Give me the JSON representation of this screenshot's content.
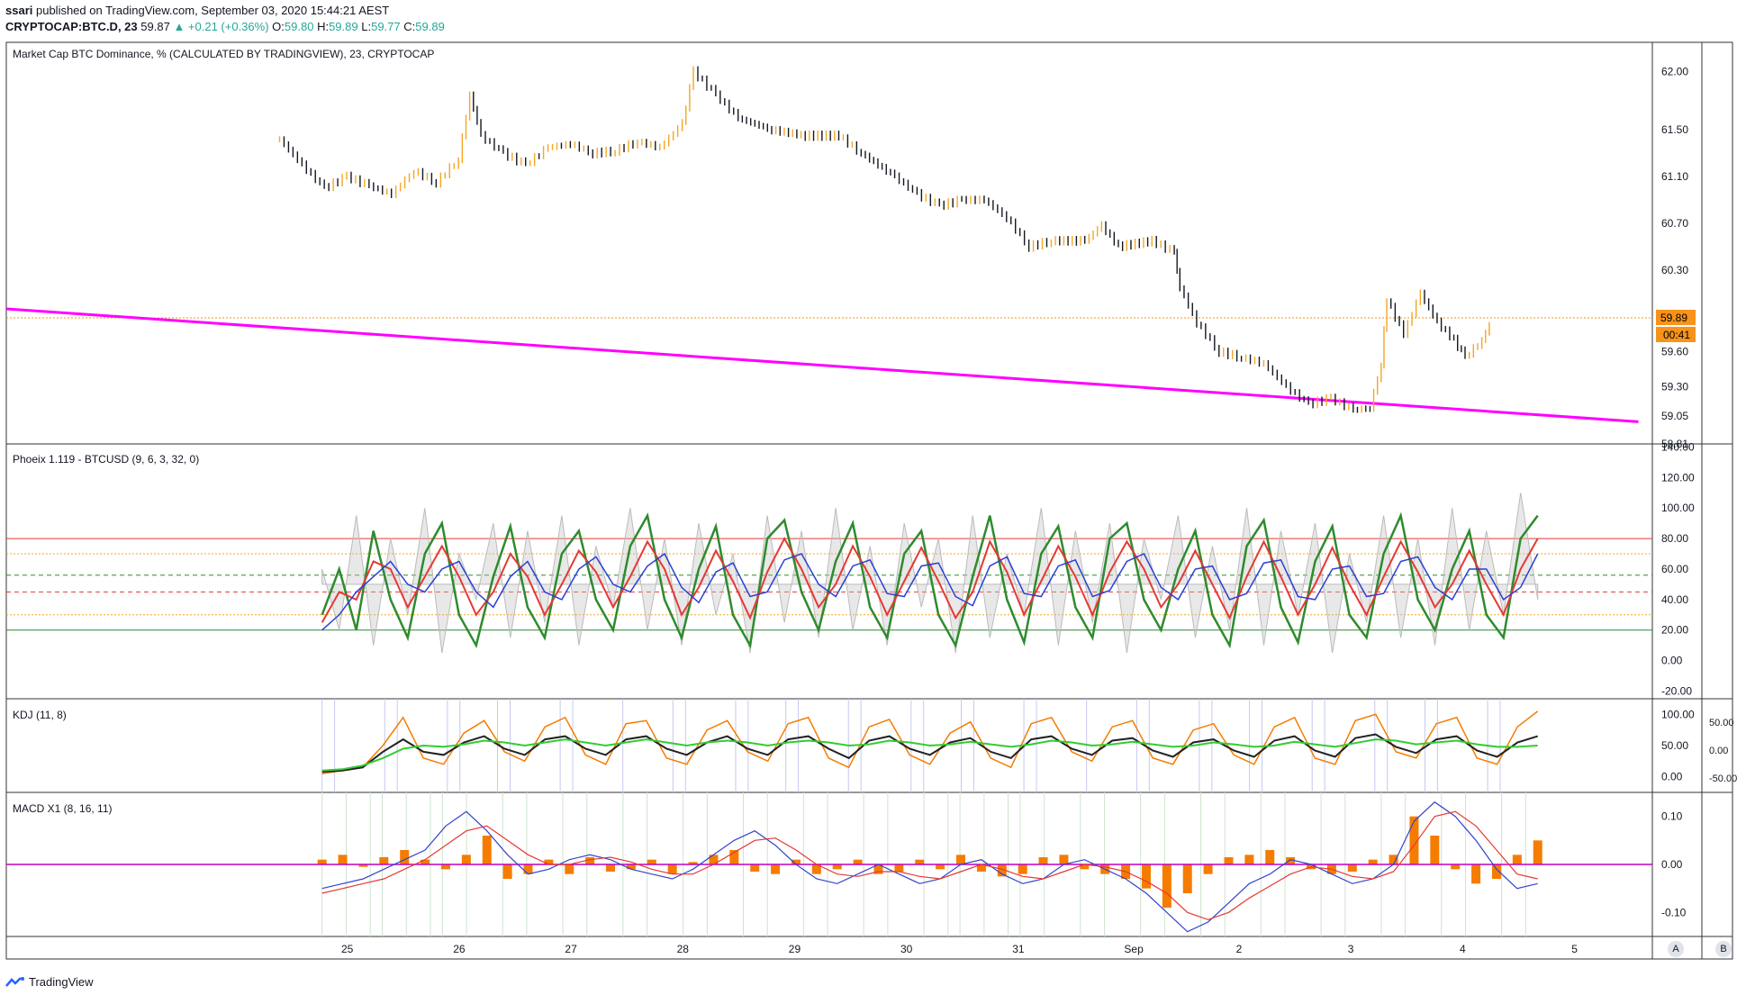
{
  "header": {
    "publisher": "ssari",
    "published_text": " published on TradingView.com, September 03, 2020 15:44:21 AEST",
    "symbol": "CRYPTOCAP:BTC.D, 23",
    "last": "59.87",
    "change": "▲ +0.21 (+0.36%)",
    "o_label": "O:",
    "o": "59.80",
    "h_label": "H:",
    "h": "59.89",
    "l_label": "L:",
    "l": "59.77",
    "c_label": "C:",
    "c": "59.89"
  },
  "panes": {
    "main_title": "Market Cap BTC Dominance, % (CALCULATED BY TRADINGVIEW), 23, CRYPTOCAP",
    "phoeix_title": "Phoeix 1.119 - BTCUSD (9, 6, 3, 32, 0)",
    "kdj_title": "KDJ (11, 8)",
    "macd_title": "MACD X1 (8, 16, 11)"
  },
  "footer": {
    "brand": "TradingView"
  },
  "buttons": {
    "a": "A",
    "b": "B"
  },
  "colors": {
    "candle": "#131722",
    "up_candle": "#f5a623",
    "trendline": "#ff00ff",
    "price_line": "#f7931a",
    "phoeix_green": "#2e8b2e",
    "phoeix_red": "#e53935",
    "phoeix_blue": "#2b3fd6",
    "kdj_k": "#f57c00",
    "kdj_d": "#222222",
    "kdj_j": "#33cc33",
    "macd_hist": "#f57c00",
    "macd_line": "#3344cc",
    "signal_line": "#e53935",
    "zero_line": "#c000c0"
  },
  "chart_data": [
    {
      "type": "line",
      "title": "Market Cap BTC Dominance, % (CALCULATED BY TRADINGVIEW), 23, CRYPTOCAP",
      "x_ticks": [
        "25",
        "26",
        "27",
        "28",
        "29",
        "30",
        "31",
        "Sep",
        "2",
        "3",
        "4",
        "5"
      ],
      "y_ticks": [
        "62.00",
        "61.50",
        "61.10",
        "60.70",
        "60.30",
        "59.89",
        "59.60",
        "59.30",
        "59.05",
        "58.81"
      ],
      "price_badge": "59.89",
      "time_badge": "00:41",
      "ylim": [
        58.81,
        62.25
      ],
      "series": [
        {
          "values": [
            [
              24.4,
              61.42
            ],
            [
              24.6,
              61.2
            ],
            [
              24.8,
              61.0
            ],
            [
              25.0,
              61.1
            ],
            [
              25.2,
              61.02
            ],
            [
              25.4,
              60.95
            ],
            [
              25.6,
              61.15
            ],
            [
              25.8,
              61.05
            ],
            [
              26.0,
              61.25
            ],
            [
              26.1,
              61.8
            ],
            [
              26.2,
              61.45
            ],
            [
              26.4,
              61.3
            ],
            [
              26.6,
              61.2
            ],
            [
              26.8,
              61.35
            ],
            [
              27.0,
              61.38
            ],
            [
              27.2,
              61.3
            ],
            [
              27.4,
              61.32
            ],
            [
              27.6,
              61.4
            ],
            [
              27.8,
              61.35
            ],
            [
              28.0,
              61.55
            ],
            [
              28.1,
              62.0
            ],
            [
              28.3,
              61.8
            ],
            [
              28.5,
              61.6
            ],
            [
              28.8,
              61.5
            ],
            [
              29.1,
              61.45
            ],
            [
              29.4,
              61.45
            ],
            [
              29.6,
              61.3
            ],
            [
              29.9,
              61.1
            ],
            [
              30.1,
              60.95
            ],
            [
              30.3,
              60.85
            ],
            [
              30.5,
              60.9
            ],
            [
              30.7,
              60.9
            ],
            [
              30.9,
              60.75
            ],
            [
              31.1,
              60.5
            ],
            [
              31.3,
              60.55
            ],
            [
              31.6,
              60.55
            ],
            [
              31.75,
              60.68
            ],
            [
              31.9,
              60.5
            ],
            [
              32.2,
              60.55
            ],
            [
              32.4,
              60.45
            ],
            [
              32.45,
              60.15
            ],
            [
              32.6,
              59.85
            ],
            [
              32.8,
              59.6
            ],
            [
              33.0,
              59.55
            ],
            [
              33.2,
              59.5
            ],
            [
              33.4,
              59.3
            ],
            [
              33.6,
              59.15
            ],
            [
              33.8,
              59.2
            ],
            [
              34.0,
              59.1
            ],
            [
              34.15,
              59.12
            ],
            [
              34.25,
              59.5
            ],
            [
              34.3,
              60.05
            ],
            [
              34.45,
              59.75
            ],
            [
              34.6,
              60.1
            ],
            [
              34.75,
              59.85
            ],
            [
              34.9,
              59.7
            ],
            [
              35.0,
              59.55
            ],
            [
              35.15,
              59.7
            ],
            [
              35.25,
              59.89
            ]
          ]
        }
      ]
    },
    {
      "type": "line",
      "title": "Phoeix 1.119 - BTCUSD (9, 6, 3, 32, 0)",
      "y_ticks": [
        "140.00",
        "120.00",
        "100.00",
        "80.00",
        "60.00",
        "40.00",
        "20.00",
        "0.00",
        "-20.00"
      ],
      "ylim": [
        -25,
        142
      ],
      "levels": [
        80,
        70,
        56,
        45,
        30,
        20
      ],
      "series": [
        {
          "name": "",
          "values": [
            30,
            60,
            20,
            85,
            40,
            15,
            70,
            90,
            30,
            10,
            55,
            88,
            35,
            15,
            70,
            85,
            40,
            20,
            75,
            95,
            40,
            15,
            60,
            88,
            30,
            10,
            80,
            92,
            45,
            20,
            65,
            90,
            35,
            15,
            70,
            85,
            30,
            10,
            55,
            95,
            40,
            12,
            70,
            88,
            35,
            15,
            80,
            90,
            40,
            20,
            60,
            85,
            30,
            10,
            75,
            92,
            35,
            12,
            65,
            88,
            30,
            15,
            70,
            95,
            40,
            20,
            60,
            85,
            30,
            15,
            80,
            95
          ]
        },
        {
          "name": "",
          "values": [
            25,
            45,
            40,
            65,
            60,
            35,
            55,
            75,
            55,
            30,
            45,
            70,
            55,
            30,
            50,
            72,
            58,
            35,
            55,
            78,
            60,
            30,
            48,
            72,
            52,
            28,
            58,
            80,
            60,
            35,
            50,
            75,
            55,
            30,
            52,
            74,
            52,
            28,
            45,
            78,
            58,
            30,
            52,
            75,
            55,
            30,
            58,
            78,
            60,
            35,
            50,
            72,
            50,
            28,
            55,
            78,
            55,
            30,
            50,
            74,
            50,
            30,
            55,
            78,
            58,
            35,
            50,
            72,
            50,
            30,
            60,
            80
          ]
        },
        {
          "name": "",
          "values": [
            20,
            30,
            45,
            55,
            65,
            50,
            45,
            60,
            65,
            45,
            35,
            55,
            65,
            45,
            40,
            60,
            68,
            50,
            45,
            62,
            70,
            48,
            38,
            58,
            64,
            42,
            45,
            66,
            70,
            50,
            42,
            62,
            66,
            44,
            42,
            62,
            64,
            42,
            36,
            62,
            68,
            44,
            42,
            62,
            66,
            42,
            46,
            65,
            70,
            48,
            40,
            60,
            62,
            40,
            44,
            64,
            66,
            42,
            40,
            60,
            62,
            42,
            44,
            65,
            68,
            48,
            40,
            60,
            60,
            40,
            48,
            70
          ]
        },
        {
          "name": "",
          "values": [
            60,
            20,
            95,
            10,
            80,
            30,
            100,
            5,
            70,
            40,
            90,
            15,
            85,
            25,
            95,
            10,
            75,
            35,
            100,
            20,
            80,
            10,
            90,
            30,
            70,
            5,
            95,
            25,
            85,
            15,
            100,
            20,
            75,
            10,
            90,
            35,
            80,
            5,
            95,
            15,
            70,
            30,
            100,
            10,
            85,
            25,
            90,
            5,
            80,
            40,
            95,
            15,
            75,
            20,
            100,
            10,
            85,
            30,
            90,
            5,
            70,
            25,
            95,
            15,
            80,
            10,
            100,
            20,
            85,
            30,
            110,
            40
          ]
        }
      ]
    },
    {
      "type": "line",
      "title": "KDJ (11, 8)",
      "y_ticks": [
        "100.00",
        "50.00",
        "0.00"
      ],
      "y_ticks_right": [
        "50.00",
        "0.00",
        "-50.00"
      ],
      "ylim": [
        -25,
        125
      ],
      "series": [
        {
          "name": "",
          "values": [
            5,
            10,
            15,
            50,
            95,
            30,
            20,
            70,
            90,
            40,
            25,
            80,
            95,
            35,
            20,
            85,
            90,
            30,
            20,
            75,
            90,
            40,
            25,
            85,
            95,
            30,
            15,
            80,
            92,
            35,
            20,
            70,
            88,
            30,
            15,
            85,
            95,
            40,
            25,
            80,
            90,
            30,
            20,
            75,
            85,
            35,
            20,
            80,
            95,
            30,
            20,
            90,
            100,
            40,
            30,
            85,
            95,
            30,
            20,
            80,
            105
          ]
        },
        {
          "name": "",
          "values": [
            8,
            10,
            15,
            40,
            60,
            40,
            35,
            55,
            65,
            45,
            35,
            60,
            65,
            45,
            35,
            60,
            65,
            45,
            35,
            55,
            65,
            45,
            35,
            60,
            65,
            45,
            30,
            58,
            65,
            45,
            35,
            55,
            62,
            40,
            30,
            60,
            65,
            45,
            35,
            58,
            62,
            42,
            32,
            55,
            60,
            42,
            32,
            58,
            65,
            42,
            32,
            62,
            68,
            48,
            38,
            60,
            65,
            42,
            32,
            55,
            65
          ]
        },
        {
          "name": "",
          "values": [
            10,
            12,
            18,
            30,
            45,
            50,
            48,
            52,
            58,
            55,
            50,
            55,
            60,
            55,
            50,
            55,
            60,
            55,
            50,
            55,
            58,
            55,
            50,
            55,
            58,
            55,
            50,
            52,
            58,
            55,
            50,
            52,
            56,
            52,
            48,
            52,
            58,
            55,
            50,
            52,
            56,
            52,
            48,
            50,
            55,
            52,
            48,
            50,
            56,
            52,
            48,
            54,
            60,
            58,
            52,
            55,
            58,
            52,
            48,
            48,
            50
          ]
        }
      ]
    },
    {
      "type": "bar",
      "title": "MACD X1 (8, 16, 11)",
      "y_ticks": [
        "0.10",
        "0.00",
        "-0.10"
      ],
      "ylim": [
        -0.15,
        0.15
      ],
      "histogram": [
        0.01,
        0.02,
        -0.005,
        0.015,
        0.03,
        0.01,
        -0.01,
        0.02,
        0.06,
        -0.03,
        -0.02,
        0.01,
        -0.02,
        0.015,
        -0.015,
        -0.01,
        0.01,
        -0.02,
        0.005,
        0.02,
        0.03,
        -0.015,
        -0.02,
        0.01,
        -0.02,
        -0.01,
        0.01,
        -0.02,
        -0.015,
        0.01,
        -0.01,
        0.02,
        -0.015,
        -0.025,
        -0.02,
        0.015,
        0.02,
        -0.01,
        -0.02,
        -0.03,
        -0.05,
        -0.09,
        -0.06,
        -0.02,
        0.015,
        0.02,
        0.03,
        0.015,
        -0.01,
        -0.02,
        -0.015,
        0.01,
        0.02,
        0.1,
        0.06,
        -0.01,
        -0.04,
        -0.03,
        0.02,
        0.05
      ],
      "series": [
        {
          "name": "",
          "values": [
            -0.05,
            -0.04,
            -0.03,
            -0.01,
            0.01,
            0.03,
            0.08,
            0.11,
            0.07,
            0.02,
            -0.02,
            -0.01,
            0.01,
            0.02,
            0.01,
            -0.01,
            -0.02,
            -0.03,
            -0.01,
            0.02,
            0.05,
            0.07,
            0.04,
            0.0,
            -0.03,
            -0.04,
            -0.02,
            0.0,
            -0.02,
            -0.04,
            -0.03,
            0.0,
            0.01,
            -0.02,
            -0.04,
            -0.03,
            0.0,
            0.01,
            -0.01,
            -0.03,
            -0.06,
            -0.1,
            -0.14,
            -0.12,
            -0.08,
            -0.04,
            -0.02,
            0.01,
            0.0,
            -0.02,
            -0.04,
            -0.03,
            0.0,
            0.09,
            0.13,
            0.1,
            0.05,
            -0.01,
            -0.05,
            -0.04
          ]
        },
        {
          "name": "",
          "values": [
            -0.06,
            -0.05,
            -0.04,
            -0.03,
            -0.01,
            0.01,
            0.04,
            0.07,
            0.08,
            0.05,
            0.02,
            0.0,
            0.0,
            0.01,
            0.015,
            0.005,
            -0.01,
            -0.02,
            -0.02,
            0.0,
            0.025,
            0.05,
            0.055,
            0.03,
            0.0,
            -0.02,
            -0.025,
            -0.015,
            -0.015,
            -0.025,
            -0.03,
            -0.015,
            0.0,
            -0.01,
            -0.025,
            -0.03,
            -0.015,
            0.0,
            -0.005,
            -0.015,
            -0.035,
            -0.06,
            -0.1,
            -0.115,
            -0.1,
            -0.07,
            -0.045,
            -0.02,
            -0.005,
            -0.01,
            -0.025,
            -0.03,
            -0.015,
            0.04,
            0.1,
            0.11,
            0.08,
            0.03,
            -0.02,
            -0.03
          ]
        }
      ]
    }
  ]
}
